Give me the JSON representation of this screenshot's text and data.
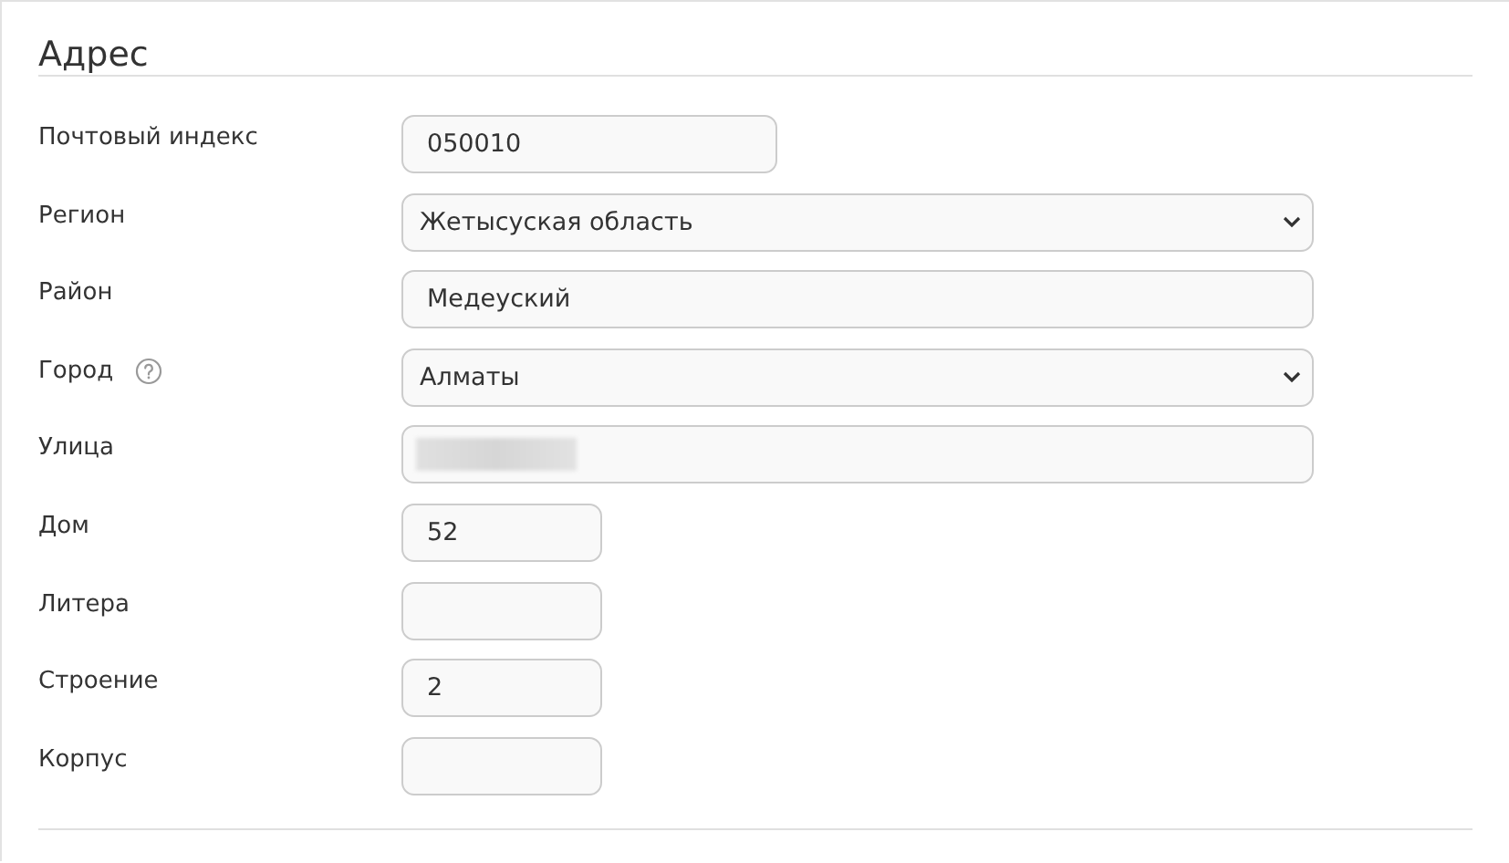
{
  "section": {
    "title": "Адрес"
  },
  "fields": [
    {
      "label": "Почтовый индекс",
      "kind": "postal",
      "value": "050010",
      "help": false,
      "redacted": false
    },
    {
      "label": "Регион",
      "kind": "select",
      "value": "Жетысуская область",
      "help": false,
      "redacted": false
    },
    {
      "label": "Район",
      "kind": "wide",
      "value": "Медеуский",
      "help": false,
      "redacted": false
    },
    {
      "label": "Город",
      "kind": "select",
      "value": "Алматы",
      "help": true,
      "redacted": false
    },
    {
      "label": "Улица",
      "kind": "wide",
      "help": false,
      "redacted": true
    },
    {
      "label": "Дом",
      "kind": "short",
      "value": "52",
      "help": false,
      "redacted": false
    },
    {
      "label": "Литера",
      "kind": "short",
      "help": false,
      "redacted": false
    },
    {
      "label": "Строение",
      "kind": "short",
      "value": "2",
      "help": false,
      "redacted": false
    },
    {
      "label": "Корпус",
      "kind": "short",
      "help": false,
      "redacted": false
    }
  ]
}
